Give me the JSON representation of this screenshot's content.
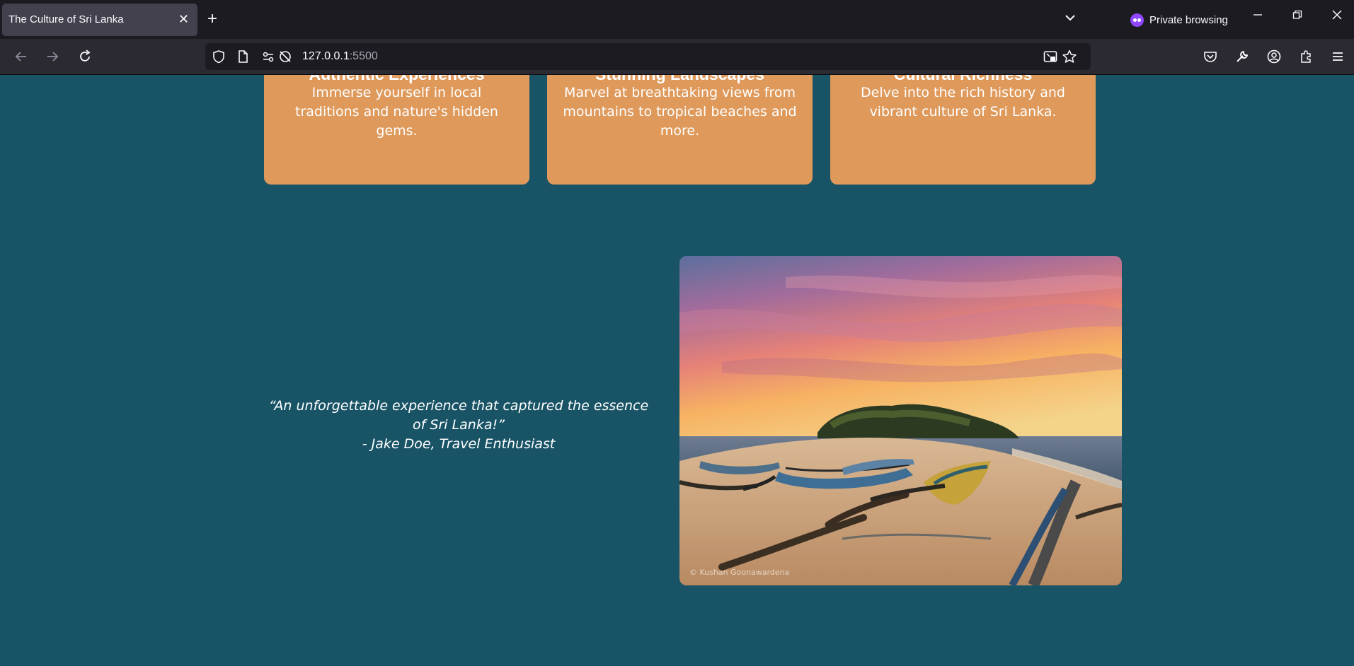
{
  "browser": {
    "tab_title": "The Culture of Sri Lanka",
    "private_label": "Private browsing",
    "url_host": "127.0.0.1",
    "url_port": ":5500"
  },
  "cards": [
    {
      "title": "Authentic Experiences",
      "text": "Immerse yourself in local traditions and nature's hidden gems."
    },
    {
      "title": "Stunning Landscapes",
      "text": "Marvel at breathtaking views from mountains to tropical beaches and more."
    },
    {
      "title": "Cultural Richness",
      "text": "Delve into the rich history and vibrant culture of Sri Lanka."
    }
  ],
  "testimonial": {
    "quote": "“An unforgettable experience that captured the essence of Sri Lanka!”",
    "author": "- Jake Doe, Travel Enthusiast"
  },
  "image": {
    "credit": "© Kushan Goonawardena"
  },
  "colors": {
    "page_bg": "#185366",
    "card_bg": "#de995b",
    "chrome_dark": "#1c1b22",
    "toolbar": "#2b2a33",
    "private_accent": "#8f48ff"
  }
}
